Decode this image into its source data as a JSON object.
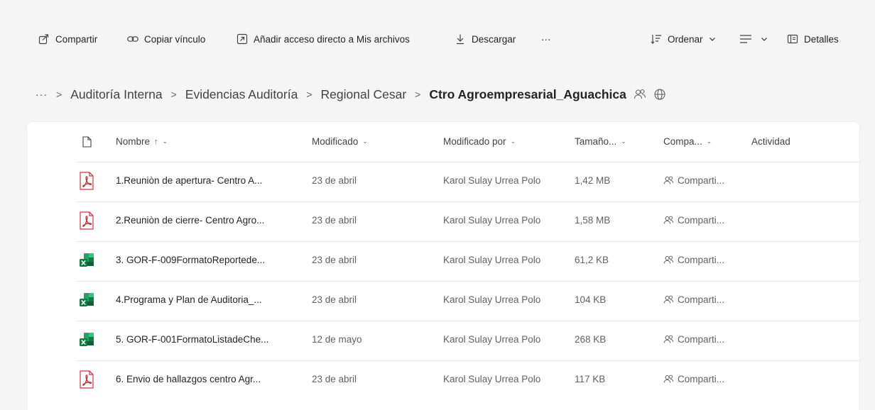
{
  "toolbar": {
    "share": "Compartir",
    "copy_link": "Copiar vínculo",
    "add_shortcut": "Añadir acceso directo a Mis archivos",
    "download": "Descargar",
    "more": "···",
    "sort": "Ordenar",
    "details": "Detalles"
  },
  "breadcrumb": {
    "overflow": "···",
    "items": [
      "Auditoría Interna",
      "Evidencias Auditoría",
      "Regional Cesar"
    ],
    "current": "Ctro Agroempresarial_Aguachica"
  },
  "table": {
    "columns": {
      "name": "Nombre",
      "name_sort": "↑",
      "modified": "Modificado",
      "modified_by": "Modificado por",
      "size": "Tamaño...",
      "sharing": "Compa...",
      "activity": "Actividad"
    },
    "rows": [
      {
        "type": "pdf",
        "name": "1.Reuniòn de apertura- Centro A...",
        "modified": "23 de abril",
        "modified_by": "Karol Sulay Urrea Polo",
        "size": "1,42 MB",
        "sharing": "Comparti..."
      },
      {
        "type": "pdf",
        "name": "2.Reuniòn de cierre- Centro Agro...",
        "modified": "23 de abril",
        "modified_by": "Karol Sulay Urrea Polo",
        "size": "1,58 MB",
        "sharing": "Comparti..."
      },
      {
        "type": "xlsx",
        "name": "3. GOR-F-009FormatoReportede...",
        "modified": "23 de abril",
        "modified_by": "Karol Sulay Urrea Polo",
        "size": "61,2 KB",
        "sharing": "Comparti..."
      },
      {
        "type": "xlsx",
        "name": "4.Programa y Plan de Auditoria_...",
        "modified": "23 de abril",
        "modified_by": "Karol Sulay Urrea Polo",
        "size": "104 KB",
        "sharing": "Comparti..."
      },
      {
        "type": "xlsx",
        "name": "5. GOR-F-001FormatoListadeChe...",
        "modified": "12 de mayo",
        "modified_by": "Karol Sulay Urrea Polo",
        "size": "268 KB",
        "sharing": "Comparti..."
      },
      {
        "type": "pdf",
        "name": "6. Envio de hallazgos centro Agr...",
        "modified": "23 de abril",
        "modified_by": "Karol Sulay Urrea Polo",
        "size": "117 KB",
        "sharing": "Comparti..."
      }
    ]
  },
  "colors": {
    "pdf_red": "#d13438",
    "excel_green": "#107c41",
    "text": "#242424",
    "muted": "#616161"
  },
  "icons": {
    "share": "share-icon",
    "copy_link": "link-icon",
    "add_shortcut": "shortcut-icon",
    "download": "download-icon",
    "sort": "sort-icon",
    "view": "view-options-icon",
    "details": "details-panel-icon",
    "shared": "people-icon",
    "web": "globe-icon"
  }
}
